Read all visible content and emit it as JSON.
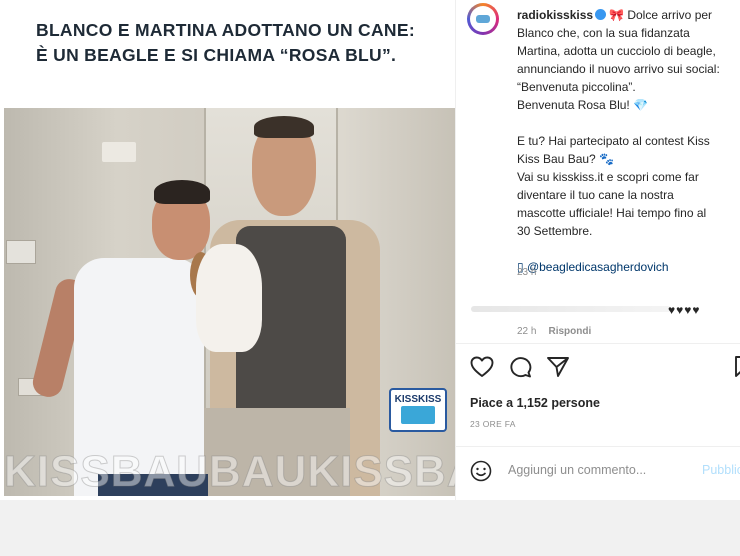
{
  "post": {
    "headline": {
      "line1": "BLANCO E MARTINA ADOTTANO UN CANE:",
      "line2": "È UN BEAGLE E SI CHIAMA “ROSA BLU”."
    },
    "watermark_text": "KISSBAUBAUKISSBAUBAUKISS",
    "logo_text": "KISSKISS"
  },
  "sidebar": {
    "username": "radiokisskiss",
    "caption": {
      "line1_rest": "🎀 Dolce arrivo per",
      "line2": "Blanco che, con la sua fidanzata",
      "line3": "Martina, adotta un cucciolo di beagle,",
      "line4": "annunciando il nuovo arrivo sui social:",
      "line5": "“Benvenuta piccolina”.",
      "line6": "Benvenuta Rosa Blu! 💎",
      "line7": "E tu? Hai partecipato al contest Kiss",
      "line8": "Kiss Bau Bau? 🐾",
      "line9": "Vai su kisskiss.it e scopri come far",
      "line10": "diventare il tuo cane la nostra",
      "line11": "mascotte ufficiale! Hai tempo fino al",
      "line12": "30 Settembre.",
      "mention": "▯ @beagledicasagherdovich"
    },
    "caption_time": "23 h",
    "comment": {
      "hearts": "♥♥♥♥",
      "time": "22 h",
      "reply": "Rispondi"
    },
    "likes": "Piace a 1,152 persone",
    "timestamp": "23 ORE FA",
    "comment_placeholder": "Aggiungi un commento...",
    "publish_label": "Pubblica"
  },
  "colors": {
    "link": "#00376b",
    "verified": "#3897f0",
    "publish": "#b2dffc",
    "muted": "#8e8e8e"
  }
}
